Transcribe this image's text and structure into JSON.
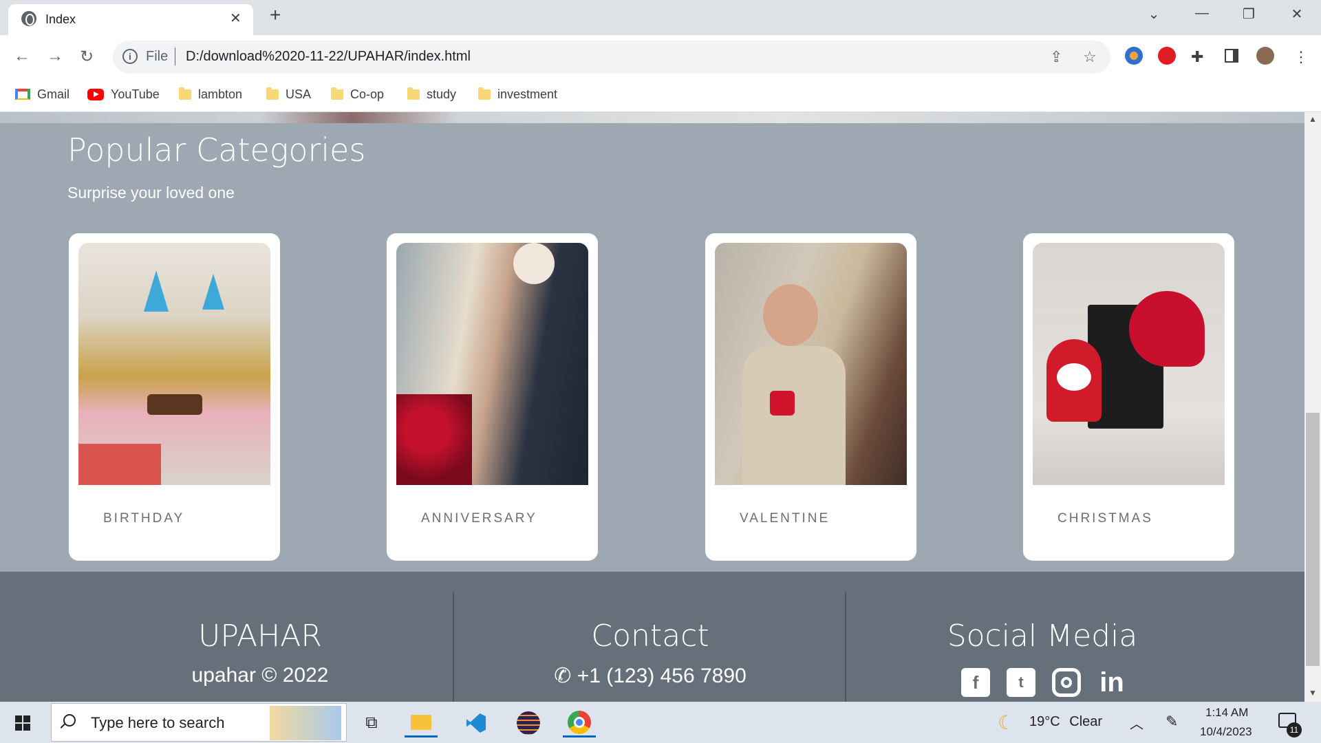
{
  "browser": {
    "tab_title": "Index",
    "tab_close": "✕",
    "new_tab": "+",
    "url_scheme": "File",
    "url": "D:/download%2020-11-22/UPAHAR/index.html",
    "bookmarks": [
      {
        "label": "Gmail",
        "icon": "gmail-icon"
      },
      {
        "label": "YouTube",
        "icon": "youtube-icon"
      },
      {
        "label": "lambton",
        "icon": "folder-icon"
      },
      {
        "label": "USA",
        "icon": "folder-icon"
      },
      {
        "label": "Co-op",
        "icon": "folder-icon"
      },
      {
        "label": "study",
        "icon": "folder-icon"
      },
      {
        "label": "investment",
        "icon": "folder-icon"
      }
    ]
  },
  "page": {
    "section_title": "Popular Categories",
    "section_subtitle": "Surprise your loved one",
    "categories": [
      {
        "label": "BIRTHDAY"
      },
      {
        "label": "ANNIVERSARY"
      },
      {
        "label": "VALENTINE"
      },
      {
        "label": "CHRISTMAS"
      }
    ],
    "footer": {
      "brand_title": "UPAHAR",
      "brand_copyright": "upahar © 2022",
      "contact_title": "Contact",
      "contact_phone": "+1 (123) 456 7890",
      "social_title": "Social Media",
      "social_icons": [
        "facebook-icon",
        "twitter-icon",
        "instagram-icon",
        "linkedin-icon"
      ]
    }
  },
  "taskbar": {
    "search_placeholder": "Type here to search",
    "weather_temp": "19°C",
    "weather_condition": "Clear",
    "time": "1:14 AM",
    "date": "10/4/2023",
    "notification_count": "11"
  }
}
